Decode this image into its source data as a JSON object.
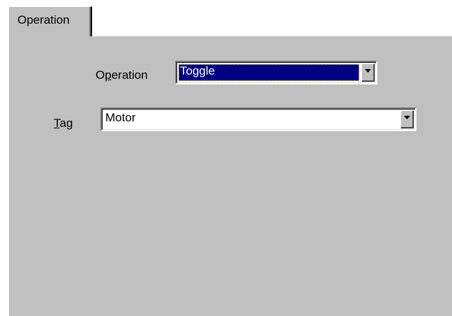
{
  "tabs": [
    {
      "label": "Operation"
    }
  ],
  "operation": {
    "label_before": "O",
    "label_mnemonic": "p",
    "label_after": "eration",
    "value": "Toggle"
  },
  "tag": {
    "label_mnemonic": "T",
    "label_after": "ag",
    "value": "Motor"
  },
  "colors": {
    "panel": "#c0c0c0",
    "selection": "#000080"
  },
  "icons": {
    "dropdown": "chevron-down-icon"
  }
}
